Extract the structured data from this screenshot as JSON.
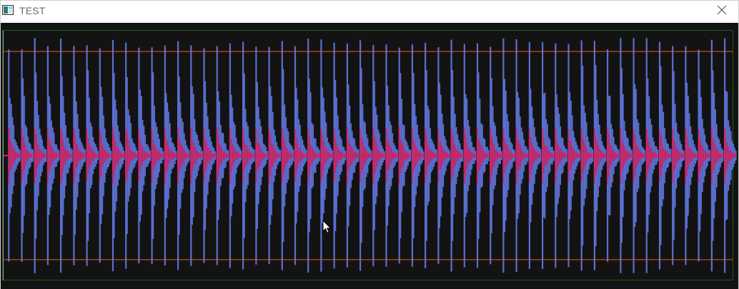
{
  "window": {
    "title": "TEST",
    "app_icon": "app-window-icon",
    "close_icon": "close-icon"
  },
  "plot": {
    "background_color": "#131313",
    "frame_color": "#1f5a1f",
    "threshold_line_color": "#e0601a",
    "threshold_levels": [
      1,
      -1
    ],
    "y_range": [
      -1.2,
      1.2
    ],
    "series": [
      {
        "role": "waveform-primary",
        "color": "#5a6fd0",
        "peak_count": 56,
        "peak_amplitude": 1.13
      },
      {
        "role": "waveform-secondary",
        "color": "#d81e5b",
        "peak_count": 56,
        "peak_amplitude": 0.28
      }
    ]
  }
}
